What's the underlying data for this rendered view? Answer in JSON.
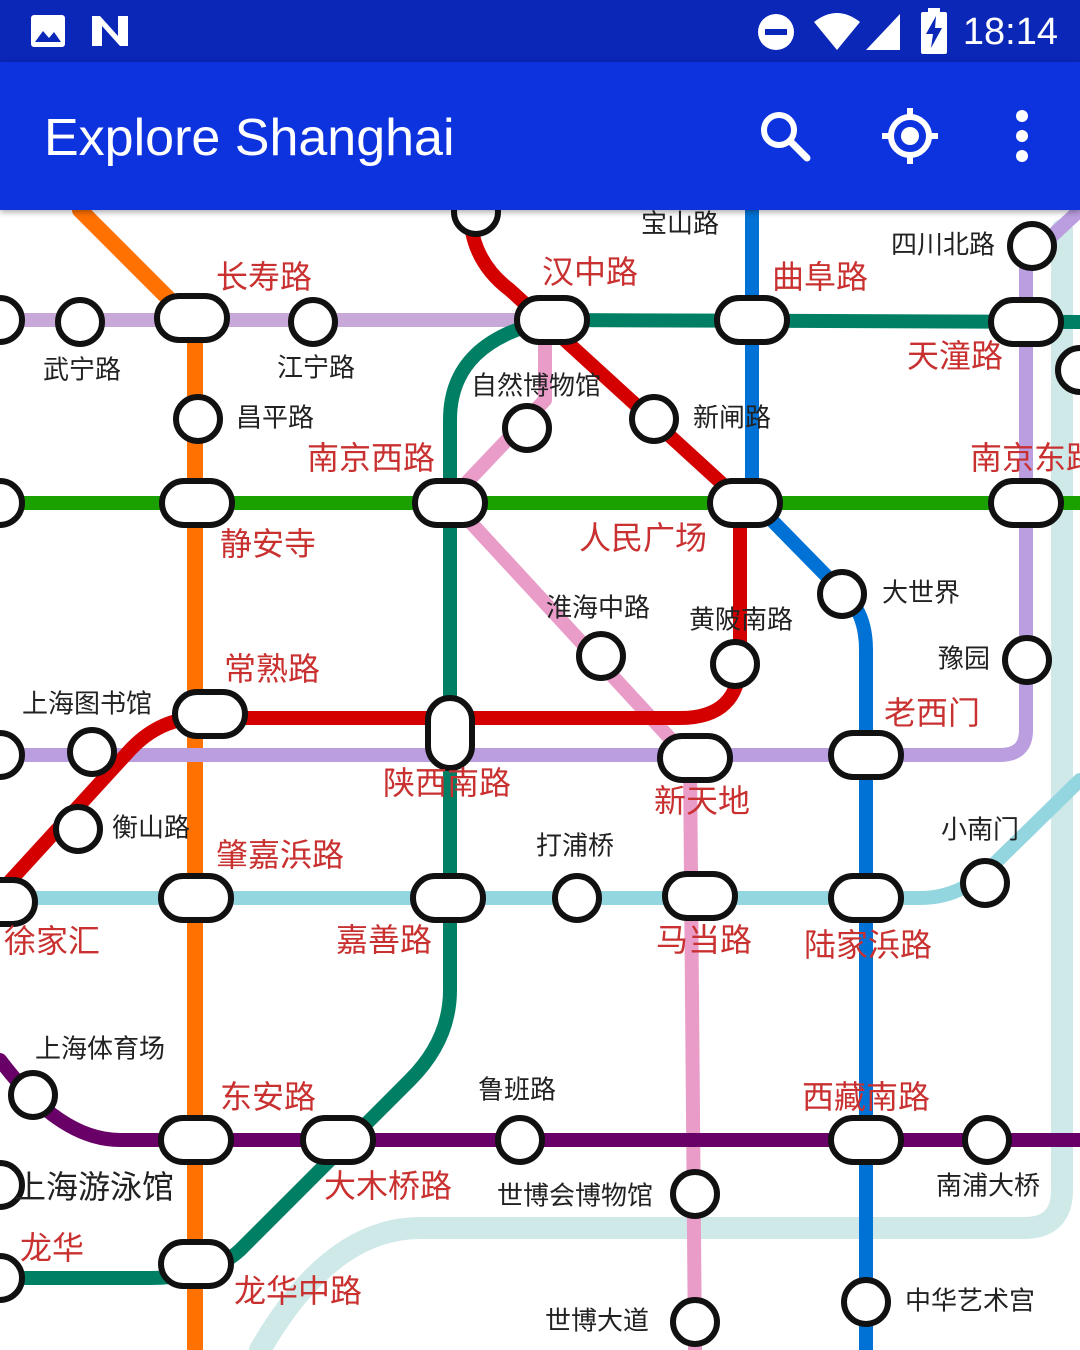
{
  "status_bar": {
    "time": "18:14",
    "left_icons": [
      "image-icon",
      "n-icon"
    ],
    "right_icons": [
      "do-not-disturb-icon",
      "wifi-icon",
      "signal-icon",
      "battery-charging-icon"
    ]
  },
  "app_bar": {
    "title": "Explore Shanghai",
    "actions": [
      "search-icon",
      "my-location-icon",
      "more-vert-icon"
    ]
  },
  "map": {
    "line_colors": {
      "line1": "#d40000",
      "line2": "#1aa100",
      "line3": "#fbc600",
      "line4": "#ba9ee0",
      "line7": "#ff7100",
      "line8": "#0072d6",
      "line9": "#94d6df",
      "line10": "#c7a8d8",
      "line12": "#007f64",
      "line13": "#e99cc8",
      "line4b": "#680068",
      "light": "#cfe8e8"
    },
    "interchange_label_color": "#c93131",
    "stations": [
      {
        "name": "宝山路",
        "type": "regular"
      },
      {
        "name": "四川北路",
        "type": "regular"
      },
      {
        "name": "汉中路",
        "type": "interchange"
      },
      {
        "name": "曲阜路",
        "type": "interchange"
      },
      {
        "name": "长寿路",
        "type": "interchange"
      },
      {
        "name": "武宁路",
        "type": "regular"
      },
      {
        "name": "江宁路",
        "type": "regular"
      },
      {
        "name": "天潼路",
        "type": "interchange"
      },
      {
        "name": "自然博物馆",
        "type": "regular"
      },
      {
        "name": "新闸路",
        "type": "regular"
      },
      {
        "name": "昌平路",
        "type": "regular"
      },
      {
        "name": "南京西路",
        "type": "interchange"
      },
      {
        "name": "南京东路",
        "type": "interchange"
      },
      {
        "name": "人民广场",
        "type": "interchange"
      },
      {
        "name": "静安寺",
        "type": "interchange"
      },
      {
        "name": "大世界",
        "type": "regular"
      },
      {
        "name": "淮海中路",
        "type": "regular"
      },
      {
        "name": "黄陂南路",
        "type": "regular"
      },
      {
        "name": "豫园",
        "type": "regular"
      },
      {
        "name": "常熟路",
        "type": "interchange"
      },
      {
        "name": "上海图书馆",
        "type": "regular"
      },
      {
        "name": "老西门",
        "type": "interchange"
      },
      {
        "name": "陕西南路",
        "type": "interchange"
      },
      {
        "name": "新天地",
        "type": "interchange"
      },
      {
        "name": "小南门",
        "type": "regular"
      },
      {
        "name": "衡山路",
        "type": "regular"
      },
      {
        "name": "肇嘉浜路",
        "type": "interchange"
      },
      {
        "name": "打浦桥",
        "type": "regular"
      },
      {
        "name": "徐家汇",
        "type": "interchange"
      },
      {
        "name": "嘉善路",
        "type": "interchange"
      },
      {
        "name": "马当路",
        "type": "interchange"
      },
      {
        "name": "陆家浜路",
        "type": "interchange"
      },
      {
        "name": "上海体育场",
        "type": "regular"
      },
      {
        "name": "东安路",
        "type": "interchange"
      },
      {
        "name": "鲁班路",
        "type": "regular"
      },
      {
        "name": "西藏南路",
        "type": "interchange"
      },
      {
        "name": "上海游泳馆",
        "type": "regular"
      },
      {
        "name": "大木桥路",
        "type": "interchange"
      },
      {
        "name": "世博会博物馆",
        "type": "regular"
      },
      {
        "name": "南浦大桥",
        "type": "regular"
      },
      {
        "name": "龙华",
        "type": "interchange"
      },
      {
        "name": "龙华中路",
        "type": "interchange"
      },
      {
        "name": "世博大道",
        "type": "regular"
      },
      {
        "name": "中华艺术宫",
        "type": "regular"
      }
    ]
  }
}
